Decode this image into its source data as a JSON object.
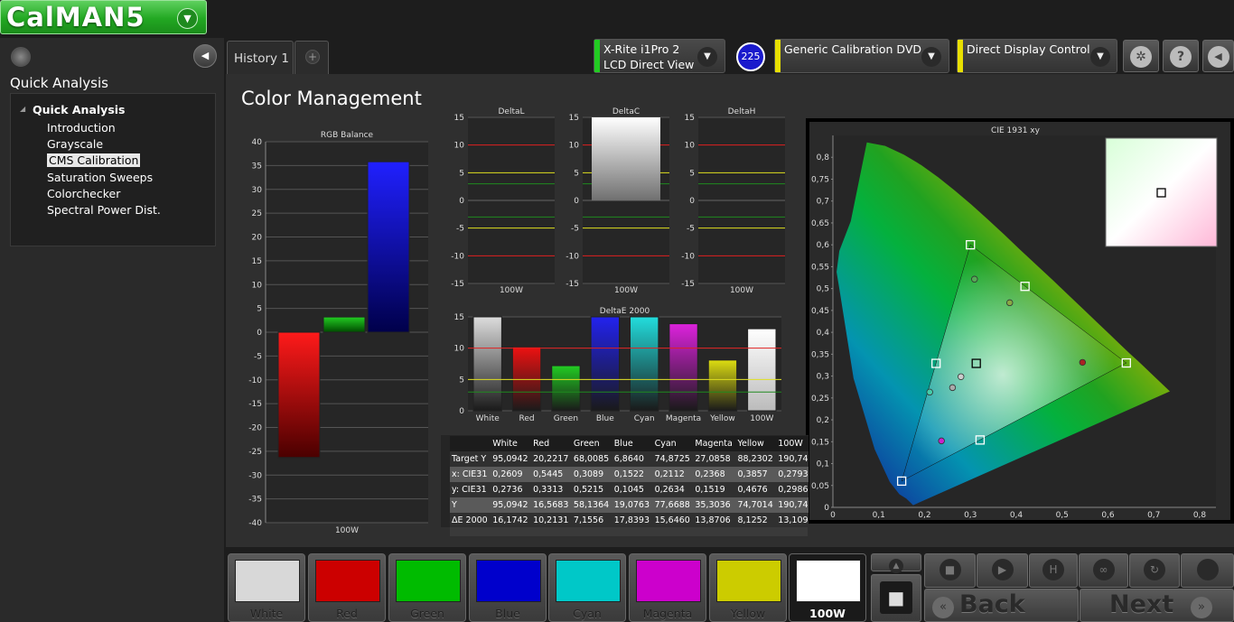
{
  "app": {
    "logo": "CalMAN5"
  },
  "sidebar": {
    "title": "Quick Analysis",
    "tree_root": "Quick Analysis",
    "items": [
      "Introduction",
      "Grayscale",
      "CMS Calibration",
      "Saturation Sweeps",
      "Colorchecker",
      "Spectral Power Dist."
    ],
    "selected": "CMS Calibration"
  },
  "tabs": {
    "active": "History 1",
    "add_icon": "plus-icon"
  },
  "devices": {
    "meter": {
      "line1": "X-Rite i1Pro 2",
      "line2": "LCD Direct View",
      "badge": "225",
      "status_color": "#22cc22"
    },
    "source": {
      "label": "Generic Calibration DVD",
      "status_color": "#e8e000"
    },
    "display": {
      "label": "Direct Display Control",
      "status_color": "#e8e000"
    }
  },
  "header_icons": [
    "gear-icon",
    "help-icon",
    "collapse-left-icon"
  ],
  "page": {
    "title": "Color Management"
  },
  "chart_data": [
    {
      "type": "bar",
      "title": "RGB Balance",
      "categories": [
        "100W"
      ],
      "series": [
        {
          "name": "Red",
          "color": "#ff1a1a",
          "values": [
            -26.3
          ]
        },
        {
          "name": "Green",
          "color": "#22cc22",
          "values": [
            3.2
          ]
        },
        {
          "name": "Blue",
          "color": "#2020ff",
          "values": [
            35.8
          ]
        }
      ],
      "ylim": [
        -40,
        40
      ],
      "yticks": [
        "40",
        "35",
        "30",
        "25",
        "20",
        "15",
        "10",
        "5",
        "0",
        "-5",
        "-10",
        "-15",
        "-20",
        "-25",
        "-30",
        "-35",
        "-40"
      ]
    },
    {
      "type": "bar",
      "title": "DeltaL",
      "categories": [
        "100W"
      ],
      "values": [
        0
      ],
      "ylim": [
        -15,
        15
      ],
      "yticks": [
        "15",
        "10",
        "5",
        "0",
        "-5",
        "-10",
        "-15"
      ]
    },
    {
      "type": "bar",
      "title": "DeltaC",
      "categories": [
        "100W"
      ],
      "values": [
        15
      ],
      "ylim": [
        -15,
        15
      ],
      "yticks": [
        "15",
        "10",
        "5",
        "0",
        "-5",
        "-10",
        "-15"
      ]
    },
    {
      "type": "bar",
      "title": "DeltaH",
      "categories": [
        "100W"
      ],
      "values": [
        0
      ],
      "ylim": [
        -15,
        15
      ],
      "yticks": [
        "15",
        "10",
        "5",
        "0",
        "-5",
        "-10",
        "-15"
      ]
    },
    {
      "type": "bar",
      "title": "DeltaE 2000",
      "categories": [
        "White",
        "Red",
        "Green",
        "Blue",
        "Cyan",
        "Magenta",
        "Yellow",
        "100W"
      ],
      "values": [
        15,
        10.2,
        7.2,
        15,
        15,
        13.9,
        8.1,
        13.1
      ],
      "colors": [
        "#dddddd",
        "#ee1111",
        "#22cc22",
        "#2222ee",
        "#22dddd",
        "#dd22dd",
        "#dddd11",
        "#ffffff"
      ],
      "ylim": [
        0,
        15
      ],
      "yticks": [
        "15",
        "10",
        "5",
        "0"
      ]
    },
    {
      "type": "scatter",
      "title": "CIE 1931 xy",
      "xlim": [
        0,
        0.85
      ],
      "ylim": [
        0,
        0.85
      ],
      "xticks": [
        "0",
        "0,1",
        "0,2",
        "0,3",
        "0,4",
        "0,5",
        "0,6",
        "0,7",
        "0,8"
      ],
      "yticks": [
        "0,8",
        "0,75",
        "0,7",
        "0,65",
        "0,6",
        "0,55",
        "0,5",
        "0,45",
        "0,4",
        "0,35",
        "0,3",
        "0,25",
        "0,2",
        "0,15",
        "0,1",
        "0,05",
        "0"
      ],
      "targets": [
        [
          0.64,
          0.33
        ],
        [
          0.3,
          0.6
        ],
        [
          0.15,
          0.06
        ],
        [
          0.225,
          0.329
        ],
        [
          0.321,
          0.154
        ],
        [
          0.419,
          0.505
        ],
        [
          0.3127,
          0.329
        ]
      ],
      "measured": [
        [
          0.5445,
          0.3313
        ],
        [
          0.3089,
          0.5215
        ],
        [
          0.2112,
          0.2634
        ],
        [
          0.2368,
          0.1519
        ],
        [
          0.3857,
          0.4676
        ],
        [
          0.2609,
          0.2736
        ],
        [
          0.2793,
          0.2986
        ]
      ],
      "measured_colors": [
        "#aa2222",
        "#55aa55",
        "#44ccaa",
        "#cc22cc",
        "#88aa44",
        "#aaaaaa",
        "#cccccc"
      ]
    }
  ],
  "table": {
    "headers": [
      "",
      "White",
      "Red",
      "Green",
      "Blue",
      "Cyan",
      "Magenta",
      "Yellow",
      "100W"
    ],
    "rows": [
      [
        "Target Y",
        "95,0942",
        "20,2217",
        "68,0085",
        "6,8640",
        "74,8725",
        "27,0858",
        "88,2302",
        "190,74"
      ],
      [
        "x: CIE31",
        "0,2609",
        "0,5445",
        "0,3089",
        "0,1522",
        "0,2112",
        "0,2368",
        "0,3857",
        "0,2793"
      ],
      [
        "y: CIE31",
        "0,2736",
        "0,3313",
        "0,5215",
        "0,1045",
        "0,2634",
        "0,1519",
        "0,4676",
        "0,2986"
      ],
      [
        "Y",
        "95,0942",
        "16,5683",
        "58,1364",
        "19,0763",
        "77,6688",
        "35,3036",
        "74,7014",
        "190,74"
      ],
      [
        "ΔE 2000",
        "16,1742",
        "10,2131",
        "7,1556",
        "17,8393",
        "15,6460",
        "13,8706",
        "8,1252",
        "13,109"
      ]
    ]
  },
  "patches": [
    {
      "label": "White",
      "color": "#d8d8d8"
    },
    {
      "label": "Red",
      "color": "#cc0000"
    },
    {
      "label": "Green",
      "color": "#00bb00"
    },
    {
      "label": "Blue",
      "color": "#0000cc"
    },
    {
      "label": "Cyan",
      "color": "#00c8c8"
    },
    {
      "label": "Magenta",
      "color": "#cc00cc"
    },
    {
      "label": "Yellow",
      "color": "#cccc00"
    },
    {
      "label": "100W",
      "color": "#ffffff"
    }
  ],
  "controls": {
    "back": "Back",
    "next": "Next",
    "icons": [
      "stop-icon",
      "play-icon",
      "hold-icon",
      "loop-icon",
      "refresh-icon"
    ]
  }
}
